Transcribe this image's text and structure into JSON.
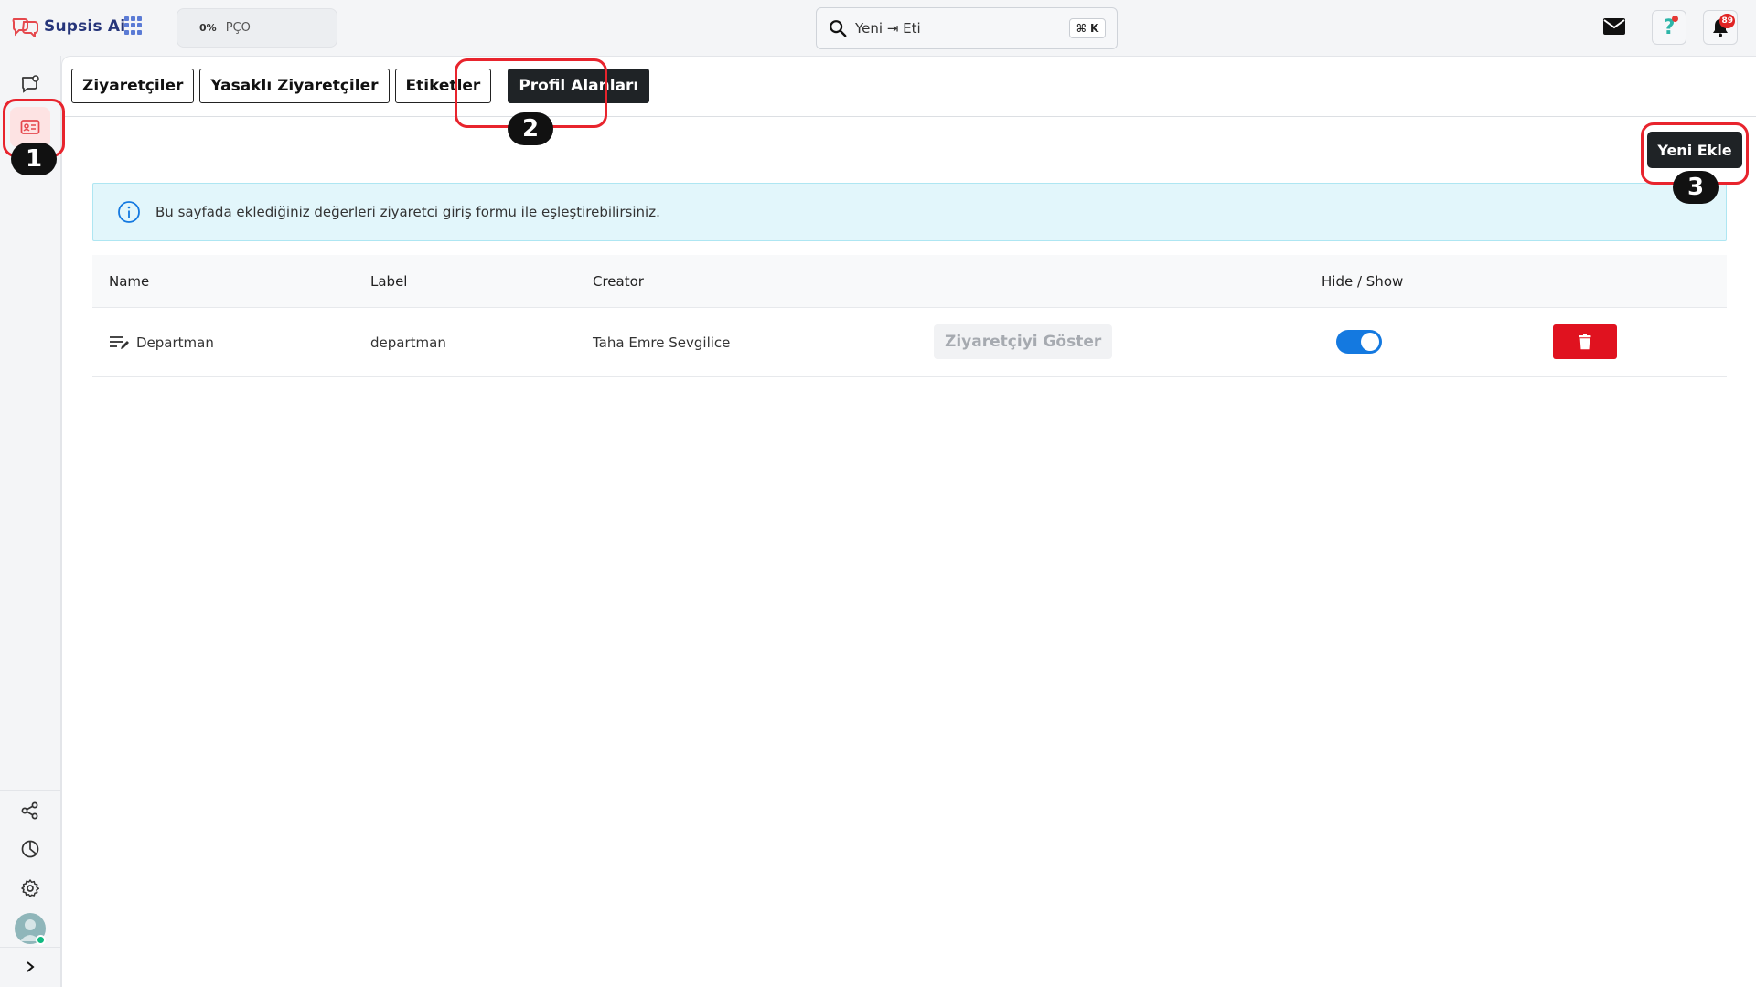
{
  "brand": {
    "name": "Supsis Ai",
    "accent": "#26357a"
  },
  "header": {
    "workspace": {
      "percent": "0%",
      "name": "PÇO"
    },
    "search": {
      "value": "Yeni ⇥ Eti",
      "shortcut": "⌘ K"
    },
    "notifications": {
      "count": "89"
    }
  },
  "icons": {
    "apps": "apps-grid-icon",
    "mail": "mail-icon",
    "help": "help-icon",
    "bell": "bell-icon"
  },
  "sidebar": {
    "items": [
      {
        "name": "chat",
        "icon": "chat-bubble-icon"
      },
      {
        "name": "contacts",
        "icon": "contact-card-icon",
        "active": true
      },
      {
        "name": "integrations",
        "icon": "share-icon"
      },
      {
        "name": "reports",
        "icon": "pie-chart-icon"
      },
      {
        "name": "settings",
        "icon": "gear-icon"
      }
    ]
  },
  "tabs": [
    {
      "label": "Ziyaretçiler"
    },
    {
      "label": "Yasaklı Ziyaretçiler"
    },
    {
      "label": "Etiketler"
    },
    {
      "label": "Profil Alanları",
      "active": true
    }
  ],
  "actions": {
    "add_label": "Yeni Ekle"
  },
  "info": {
    "text": "Bu sayfada eklediğiniz değerleri ziyaretci giriş formu ile eşleştirebilirsiniz."
  },
  "table": {
    "headers": {
      "name": "Name",
      "label": "Label",
      "creator": "Creator",
      "toggle": "Hide / Show"
    },
    "rows": [
      {
        "name": "Departman",
        "label": "departman",
        "creator": "Taha Emre Sevgilice",
        "action": "Ziyaretçiyi Göster",
        "visible": true
      }
    ]
  },
  "annotations": [
    "1",
    "2",
    "3"
  ],
  "colors": {
    "active_tab": "#1f2326",
    "toggle_on": "#1479e0",
    "delete": "#e0121f",
    "info_bg": "#e2f6fb",
    "callout": "#e8242d"
  }
}
